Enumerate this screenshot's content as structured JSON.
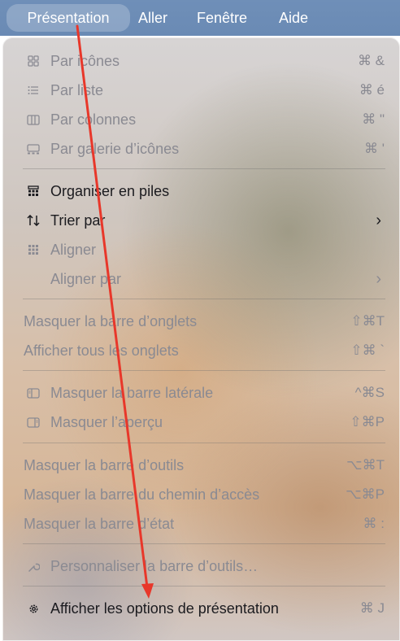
{
  "menubar": {
    "items": [
      "Présentation",
      "Aller",
      "Fenêtre",
      "Aide"
    ]
  },
  "menu": {
    "items": [
      {
        "label": "Par icônes",
        "shortcut": "⌘ &",
        "icon": "grid-icon"
      },
      {
        "label": "Par liste",
        "shortcut": "⌘ é",
        "icon": "list-icon"
      },
      {
        "label": "Par colonnes",
        "shortcut": "⌘ \"",
        "icon": "columns-icon"
      },
      {
        "label": "Par galerie d’icônes",
        "shortcut": "⌘ '",
        "icon": "gallery-icon"
      },
      {
        "label": "Organiser en piles",
        "icon": "stacks-icon"
      },
      {
        "label": "Trier par",
        "icon": "sort-icon",
        "submenu": "›"
      },
      {
        "label": "Aligner",
        "icon": "align-grid-icon"
      },
      {
        "label": "Aligner par",
        "submenu": "›"
      },
      {
        "label": "Masquer la barre d’onglets",
        "shortcut": "⇧⌘T"
      },
      {
        "label": "Afficher tous les onglets",
        "shortcut": "⇧⌘ `"
      },
      {
        "label": "Masquer la barre latérale",
        "shortcut": "^⌘S",
        "icon": "sidebar-icon"
      },
      {
        "label": "Masquer l’aperçu",
        "shortcut": "⇧⌘P",
        "icon": "preview-icon"
      },
      {
        "label": "Masquer la barre d’outils",
        "shortcut": "⌥⌘T"
      },
      {
        "label": "Masquer la barre du chemin d’accès",
        "shortcut": "⌥⌘P"
      },
      {
        "label": "Masquer la barre d’état",
        "shortcut": "⌘ :"
      },
      {
        "label": "Personnaliser la barre d’outils…",
        "icon": "wrench-icon"
      },
      {
        "label": "Afficher les options de présentation",
        "shortcut": "⌘ J",
        "icon": "gear-icon"
      }
    ]
  },
  "colors": {
    "menubar": "#6f8fb8",
    "arrow": "#e8372a",
    "dimmed_text": "#8a8a92",
    "active_text": "#1b1b1f"
  }
}
